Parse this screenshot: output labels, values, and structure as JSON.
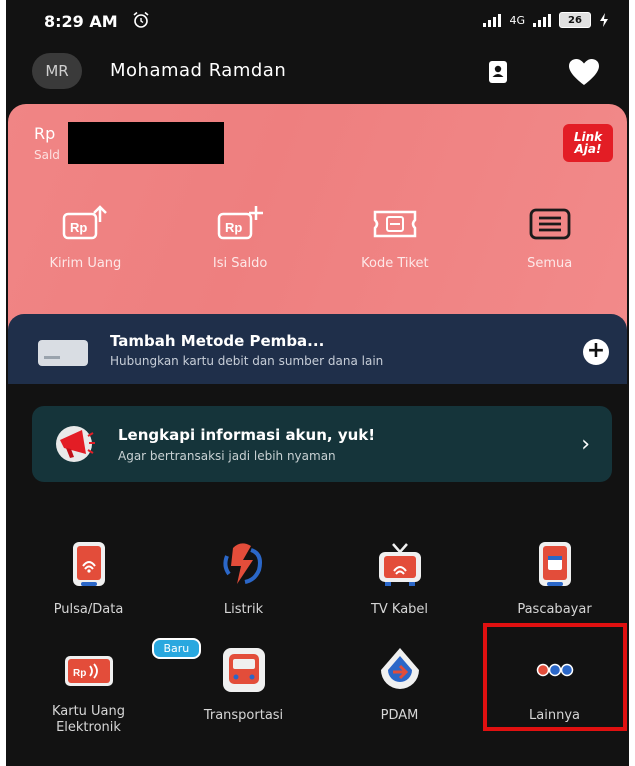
{
  "status": {
    "time": "8:29 AM",
    "network": "4G",
    "battery": "26"
  },
  "header": {
    "avatar_initials": "MR",
    "name": "Mohamad Ramdan"
  },
  "balance": {
    "currency": "Rp",
    "saldo_label": "Sald",
    "logo_top": "Link",
    "logo_bottom": "Aja!",
    "actions": [
      {
        "label": "Kirim Uang",
        "icon": "send-money-icon"
      },
      {
        "label": "Isi Saldo",
        "icon": "topup-icon"
      },
      {
        "label": "Kode Tiket",
        "icon": "ticket-icon"
      },
      {
        "label": "Semua",
        "icon": "menu-icon"
      }
    ]
  },
  "payment_method": {
    "title": "Tambah Metode Pemba...",
    "subtitle": "Hubungkan kartu debit dan sumber dana lain"
  },
  "account_info": {
    "title": "Lengkapi informasi akun, yuk!",
    "subtitle": "Agar bertransaksi jadi lebih nyaman"
  },
  "services": [
    {
      "label": "Pulsa/Data",
      "icon": "phone-icon"
    },
    {
      "label": "Listrik",
      "icon": "electricity-icon"
    },
    {
      "label": "TV Kabel",
      "icon": "tv-icon"
    },
    {
      "label": "Pascabayar",
      "icon": "postpaid-icon"
    },
    {
      "label": "Kartu Uang Elektronik",
      "icon": "ecard-icon",
      "badge": "Baru"
    },
    {
      "label": "Transportasi",
      "icon": "bus-icon"
    },
    {
      "label": "PDAM",
      "icon": "water-icon"
    },
    {
      "label": "Lainnya",
      "icon": "more-icon"
    }
  ],
  "colors": {
    "card": "#f08585",
    "brand_red": "#e31d25",
    "highlight": "#e01010"
  }
}
